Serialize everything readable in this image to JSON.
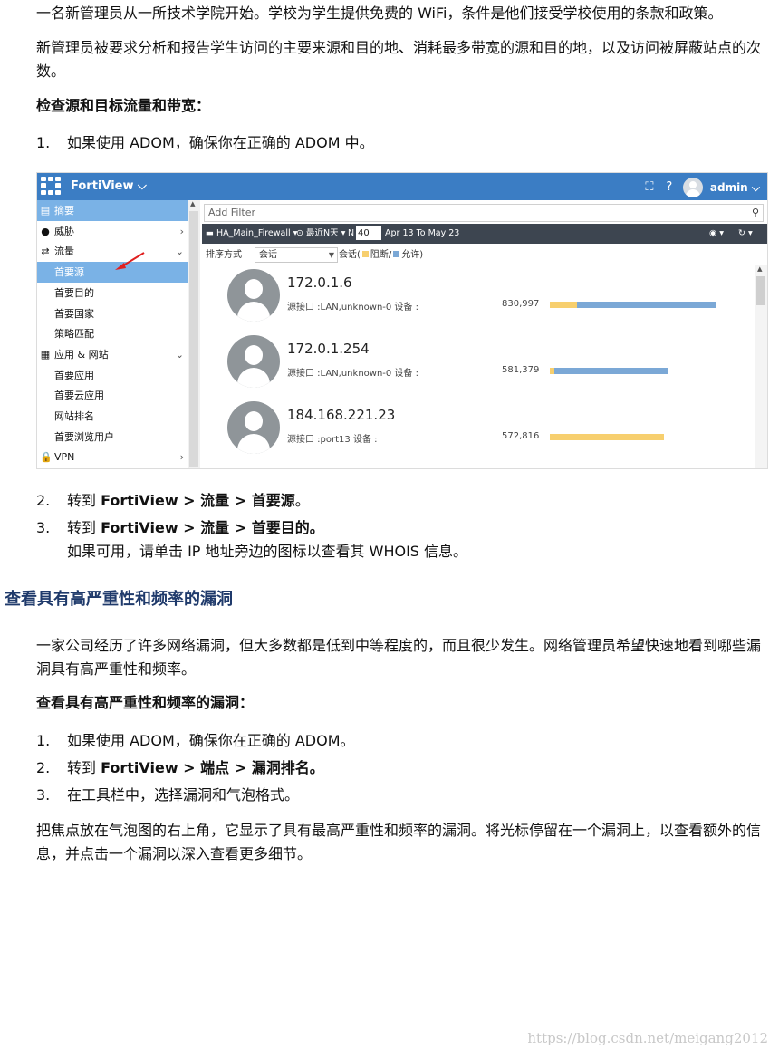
{
  "intro": {
    "line1": "一名新管理员从一所技术学院开始。学校为学生提供免费的 WiFi，条件是他们接受学校使用的条款和政策。",
    "para2": "新管理员被要求分析和报告学生访问的主要来源和目的地、消耗最多带宽的源和目的地，以及访问被屏蔽站点的次数。",
    "heading": "检查源和目标流量和带宽："
  },
  "steps_a": [
    {
      "num": "1.",
      "text": "如果使用 ADOM，确保你在正确的 ADOM 中。"
    }
  ],
  "screenshot": {
    "app_title": "FortiView ⌵",
    "user": "admin ⌵",
    "sidebar": [
      {
        "icon": "▤",
        "label": "摘要",
        "selected": true,
        "chevron": ""
      },
      {
        "icon": "●",
        "label": "威胁",
        "chevron": "›"
      },
      {
        "icon": "⇄",
        "label": "流量",
        "chevron": "⌄"
      },
      {
        "icon": "",
        "label": "首要源",
        "selected": true,
        "chevron": ""
      },
      {
        "icon": "",
        "label": "首要目的",
        "chevron": ""
      },
      {
        "icon": "",
        "label": "首要国家",
        "chevron": ""
      },
      {
        "icon": "",
        "label": "策略匹配",
        "chevron": ""
      },
      {
        "icon": "▦",
        "label": "应用 & 网站",
        "chevron": "⌄"
      },
      {
        "icon": "",
        "label": "首要应用",
        "chevron": ""
      },
      {
        "icon": "",
        "label": "首要云应用",
        "chevron": ""
      },
      {
        "icon": "",
        "label": "网站排名",
        "chevron": ""
      },
      {
        "icon": "",
        "label": "首要浏览用户",
        "chevron": ""
      },
      {
        "icon": "🔒",
        "label": "VPN",
        "chevron": "›"
      }
    ],
    "filter_placeholder": "Add Filter",
    "device": "HA_Main_Firewall ▾",
    "time_range": "⊙ 最近N天 ▾",
    "n_label": "N",
    "n_value": "40",
    "date_range": "Apr 13 To May 23",
    "sort_label": "排序方式",
    "sort_value": "会话",
    "legend_prefix": "会话(",
    "legend_blocked": "阻断/",
    "legend_allowed": "允许)",
    "colors": {
      "blocked": "#f7cf6e",
      "allowed": "#7ba8d6",
      "accent": "#3b7dc4"
    },
    "entries": [
      {
        "ip": "172.0.1.6",
        "info": "源接口 :LAN,unknown-0   设备 :",
        "count": "830,997",
        "blocked": 30,
        "allowed": 154
      },
      {
        "ip": "172.0.1.254",
        "info": "源接口 :LAN,unknown-0   设备 :",
        "count": "581,379",
        "blocked": 5,
        "allowed": 125
      },
      {
        "ip": "184.168.221.23",
        "info": "源接口 :port13   设备 :",
        "count": "572,816",
        "blocked": 126,
        "allowed": 0
      }
    ]
  },
  "steps_b": [
    {
      "num": "2.",
      "pre": "转到 ",
      "b1": "FortiView > 流量 > 首要源",
      "post": "。"
    },
    {
      "num": "3.",
      "pre": "转到 ",
      "b1": "FortiView > 流量 > 首要目的。",
      "post": ""
    }
  ],
  "step3_note": "如果可用，请单击 IP 地址旁边的图标以查看其 WHOIS 信息。",
  "section2": {
    "title": "查看具有高严重性和频率的漏洞",
    "para": "一家公司经历了许多网络漏洞，但大多数都是低到中等程度的，而且很少发生。网络管理员希望快速地看到哪些漏洞具有高严重性和频率。",
    "heading": "查看具有高严重性和频率的漏洞：",
    "step1": {
      "num": "1.",
      "text": "如果使用 ADOM，确保你在正确的 ADOM。"
    },
    "step2": {
      "num": "2.",
      "pre": "转到 ",
      "b1": "FortiView > 端点 > 漏洞排名。"
    },
    "step3": {
      "num": "3.",
      "text": "在工具栏中，选择漏洞和气泡格式。"
    },
    "closing": "把焦点放在气泡图的右上角，它显示了具有最高严重性和频率的漏洞。将光标停留在一个漏洞上，以查看额外的信息，并点击一个漏洞以深入查看更多细节。"
  },
  "watermark": "https://blog.csdn.net/meigang2012"
}
